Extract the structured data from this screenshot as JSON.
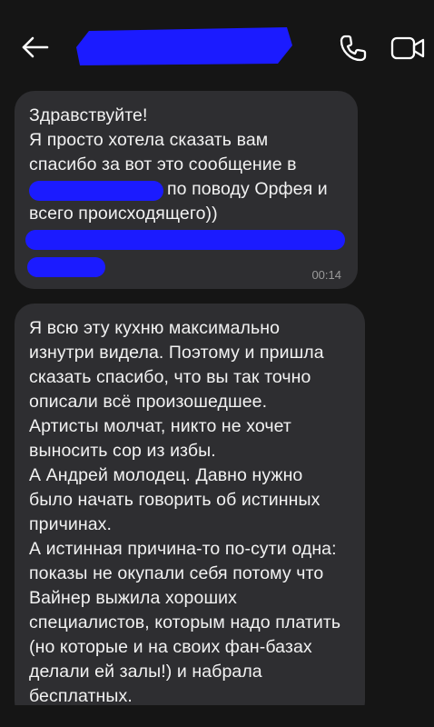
{
  "colors": {
    "background": "#151515",
    "bubble": "#2e2e31",
    "text": "#f2f2f2",
    "timestamp": "#9a9a9a",
    "redaction": "#1b1bff"
  },
  "header": {
    "back_icon": "arrow-left-icon",
    "call_icon": "phone-icon",
    "video_icon": "video-camera-icon"
  },
  "messages": [
    {
      "lines": [
        "Здравствуйте!",
        "Я просто хотела сказать вам",
        "спасибо за вот это сообщение в",
        "по поводу Орфея и",
        "всего происходящего))"
      ],
      "time": "00:14"
    },
    {
      "lines": [
        "Я всю эту кухню максимально",
        "изнутри видела. Поэтому и пришла",
        "сказать спасибо, что вы так точно",
        "описали всё произошедшее.",
        "Артисты молчат, никто не хочет",
        "выносить сор из избы.",
        "А Андрей молодец. Давно нужно",
        "было начать говорить об истинных",
        "причинах.",
        "А истинная причина-то по-сути одна:",
        "показы не окупали себя потому что",
        "Вайнер выжила  хороших",
        "специалистов, которым  надо платить",
        "(но которые и на  своих фан-базах",
        "делали ей залы!) и  набрала",
        "бесплатных."
      ]
    }
  ]
}
